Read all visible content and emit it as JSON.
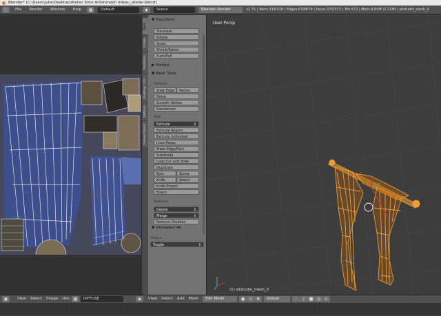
{
  "window": {
    "title": "Blender* [C:\\Users\\Julie\\Desktop\\Atelier Sims Artist\\mesh rideau_atelier.blend]"
  },
  "top_menu": {
    "items": [
      "File",
      "Render",
      "Window",
      "Help"
    ],
    "layout": "Default",
    "scene": "Scene",
    "engine": "Blender Render",
    "stats": "v2.75 | Verts:318/318 | Edges:679/679 | Faces:372/372 | Tris:572 | Mem:9.05M (2.11M) | sitstudio_mesh_0"
  },
  "toolshelf": {
    "tabs": [
      "Tools",
      "Create",
      "Relations",
      "Shading / UVs",
      "Options",
      "Grease Pencil"
    ],
    "transform": {
      "header": "Transform",
      "buttons": [
        "Translate",
        "Rotate",
        "Scale",
        "Shrink/Fatten",
        "Push/Pull"
      ]
    },
    "history_header": "History",
    "mesh_tools": {
      "header": "Mesh Tools",
      "deform_label": "Deform:",
      "slide_edge": "Slide Edge",
      "vertex": "Vertex",
      "noise": "Noise",
      "smooth_vertex": "Smooth Vertex",
      "randomize": "Randomize",
      "add_label": "Add:",
      "extrude": "Extrude",
      "add_buttons": [
        "Extrude Region",
        "Extrude Individual",
        "Inset Faces",
        "Make Edge/Face",
        "Subdivide",
        "Loop Cut and Slide",
        "Duplicate"
      ],
      "spin": "Spin",
      "screw": "Screw",
      "knife": "Knife",
      "select": "Select",
      "knife_project": "Knife Project",
      "bisect": "Bisect",
      "remove_label": "Remove:",
      "delete": "Delete",
      "merge": "Merge",
      "remove_doubles": "Remove Doubles"
    },
    "operator": {
      "header": "(De)select All",
      "action_label": "Action",
      "action_value": "Toggle"
    }
  },
  "viewport": {
    "view_label": "User Persp",
    "object_label": "(1) sitstudio_mesh_0"
  },
  "bottom_uv": {
    "items": [
      "View",
      "Select",
      "Image",
      "UVs"
    ],
    "image_name": "DIFFUSE"
  },
  "bottom_3d": {
    "items": [
      "View",
      "Select",
      "Add",
      "Mesh"
    ],
    "mode": "Edit Mode",
    "orientation": "Global"
  },
  "colors": {
    "mesh_wire": "#f0a030",
    "mesh_dark": "#c0640c",
    "panel_bg": "#727272",
    "viewport_bg": "#3d3d3d",
    "accent": "#e87d0d"
  }
}
